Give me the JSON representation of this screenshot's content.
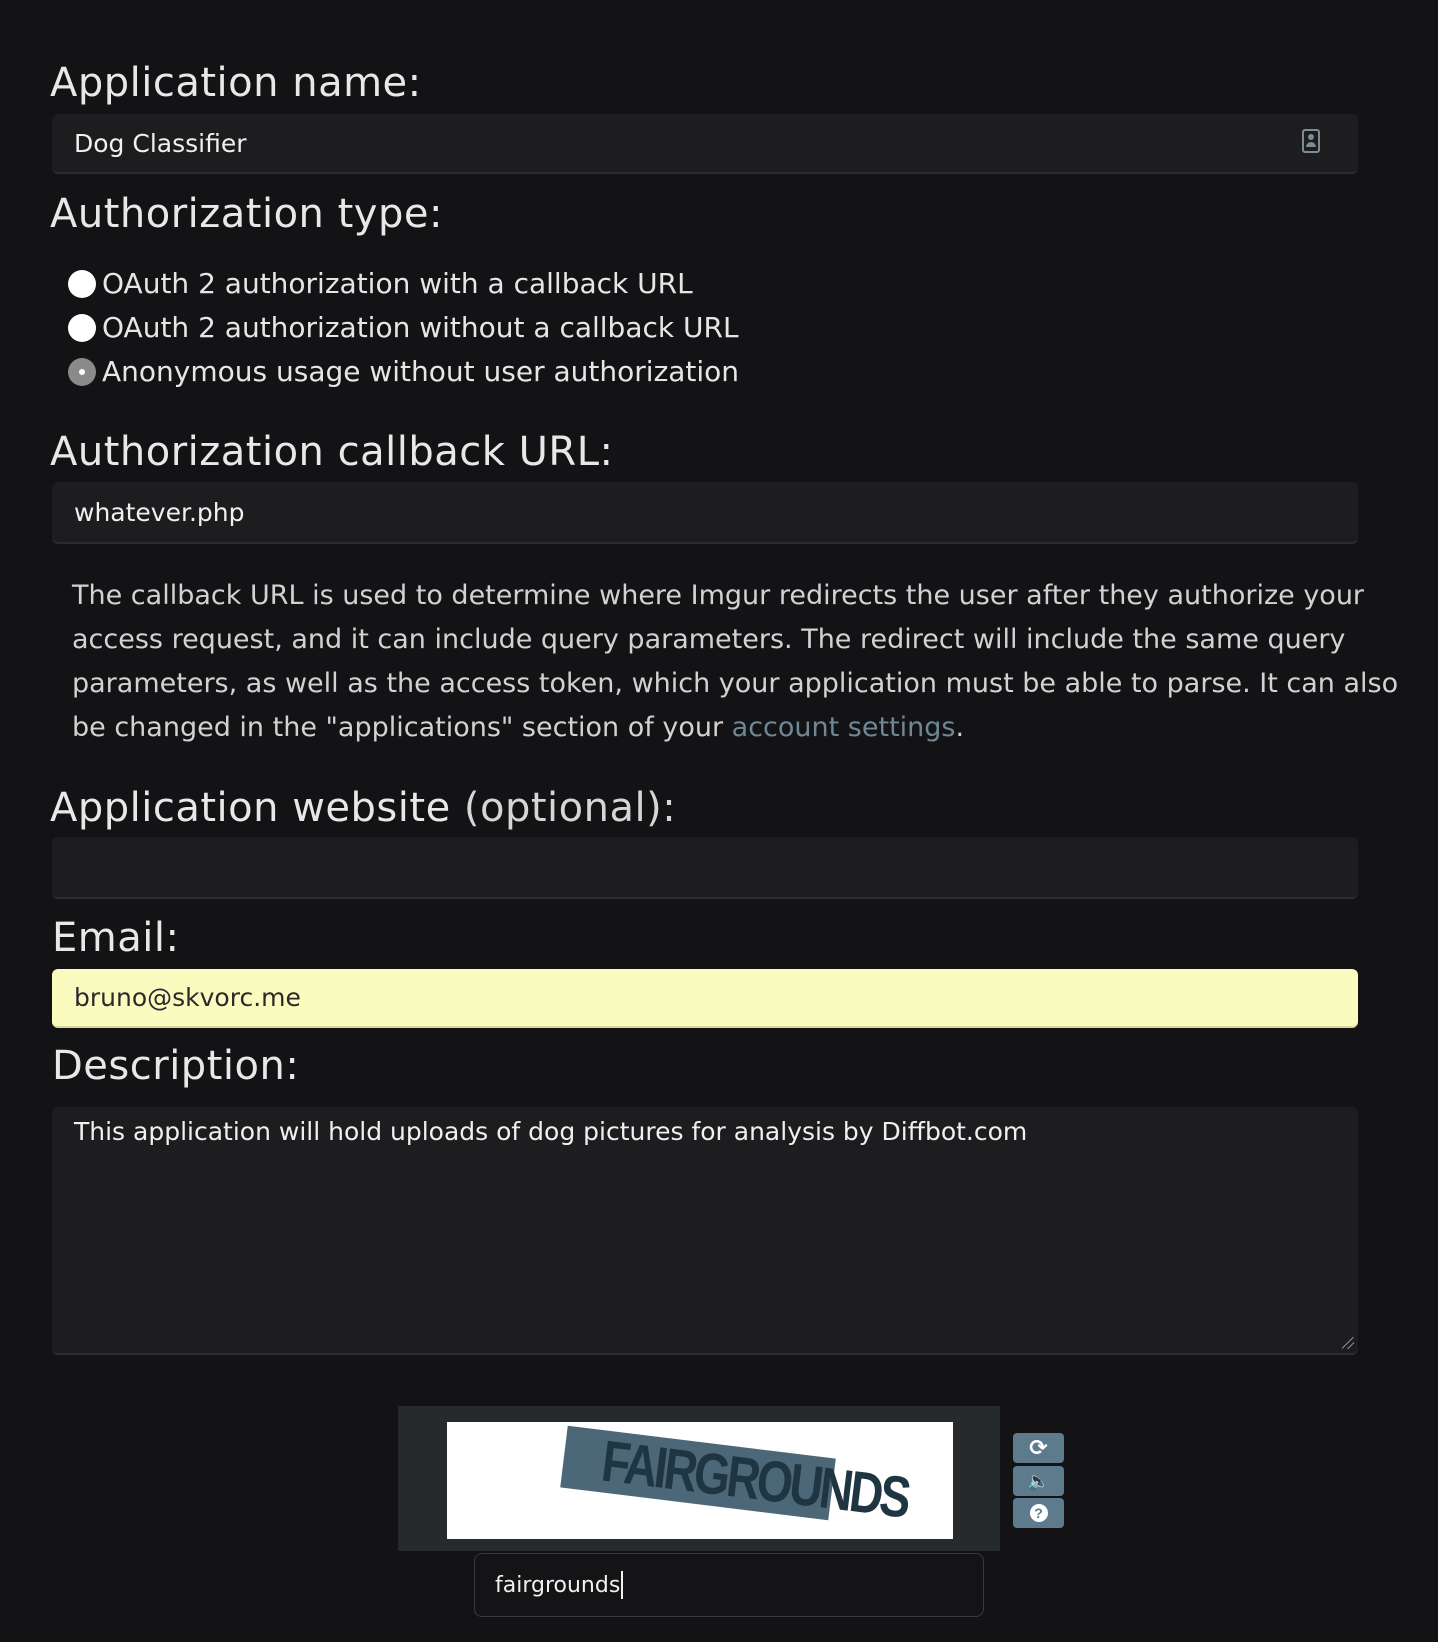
{
  "application_name": {
    "label": "Application name:",
    "value": "Dog Classifier"
  },
  "authorization_type": {
    "label": "Authorization type:",
    "options": [
      {
        "label": "OAuth 2 authorization with a callback URL",
        "checked": false
      },
      {
        "label": "OAuth 2 authorization without a callback URL",
        "checked": false
      },
      {
        "label": "Anonymous usage without user authorization",
        "checked": true
      }
    ]
  },
  "callback_url": {
    "label": "Authorization callback URL:",
    "value": "whatever.php",
    "help_text": "The callback URL is used to determine where Imgur redirects the user after they authorize your access request, and it can include query parameters. The redirect will include the same query parameters, as well as the access token, which your application must be able to parse. It can also be changed in the \"applications\" section of your ",
    "help_link": "account settings",
    "help_end": "."
  },
  "website": {
    "label": "Application website",
    "label_optional": "(optional):",
    "value": ""
  },
  "email": {
    "label": "Email:",
    "value": "bruno@skvorc.me",
    "autofill_color": "#fafbbf"
  },
  "description": {
    "label": "Description:",
    "value": "This application will hold uploads of dog pictures for analysis by Diffbot.com"
  },
  "captcha": {
    "image_word": "FAIRGROUNDS",
    "response_value": "fairgrounds",
    "buttons": [
      {
        "icon": "refresh-icon",
        "glyph": "⟳"
      },
      {
        "icon": "audio-icon",
        "glyph": "🔈"
      },
      {
        "icon": "help-icon",
        "glyph": "?"
      }
    ]
  },
  "colors": {
    "background": "#131316",
    "field_background": "#1d1d1f",
    "link": "#6f8794",
    "captcha_button": "#5d7b8c"
  }
}
